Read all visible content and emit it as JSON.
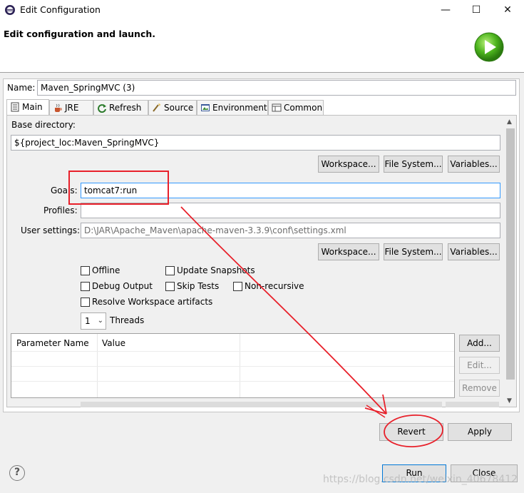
{
  "window": {
    "title": "Edit Configuration",
    "minimize": "—",
    "maximize": "☐",
    "close": "✕"
  },
  "header": {
    "text": "Edit configuration and launch."
  },
  "name": {
    "label": "Name:",
    "value": "Maven_SpringMVC (3)"
  },
  "tabs": [
    {
      "label": "Main",
      "icon": "main-tab-icon",
      "active": true
    },
    {
      "label": "JRE",
      "icon": "jre-tab-icon"
    },
    {
      "label": "Refresh",
      "icon": "refresh-tab-icon"
    },
    {
      "label": "Source",
      "icon": "source-tab-icon"
    },
    {
      "label": "Environment",
      "icon": "environment-tab-icon"
    },
    {
      "label": "Common",
      "icon": "common-tab-icon"
    }
  ],
  "main": {
    "base_dir_label": "Base directory:",
    "base_dir_value": "${project_loc:Maven_SpringMVC}",
    "workspace_btn": "Workspace...",
    "filesystem_btn": "File System...",
    "variables_btn": "Variables...",
    "goals_label": "Goals:",
    "goals_value": "tomcat7:run",
    "profiles_label": "Profiles:",
    "profiles_value": "",
    "user_settings_label": "User settings:",
    "user_settings_value": "D:\\JAR\\Apache_Maven\\apache-maven-3.3.9\\conf\\settings.xml",
    "workspace_btn2": "Workspace...",
    "filesystem_btn2": "File System...",
    "variables_btn2": "Variables...",
    "offline": "Offline",
    "update_snapshots": "Update Snapshots",
    "debug_output": "Debug Output",
    "skip_tests": "Skip Tests",
    "non_recursive": "Non-recursive",
    "resolve_workspace": "Resolve Workspace artifacts",
    "threads_value": "1",
    "threads_label": "Threads",
    "table": {
      "headers": [
        "Parameter Name",
        "Value"
      ]
    },
    "add_btn": "Add...",
    "edit_btn": "Edit...",
    "remove_btn": "Remove"
  },
  "buttons": {
    "revert": "Revert",
    "apply": "Apply",
    "run": "Run",
    "close": "Close"
  },
  "help": "?",
  "watermark": "https://blog.csdn.net/weixin_40678412",
  "colors": {
    "annotation": "#e8202a",
    "focus": "#3399ff"
  }
}
